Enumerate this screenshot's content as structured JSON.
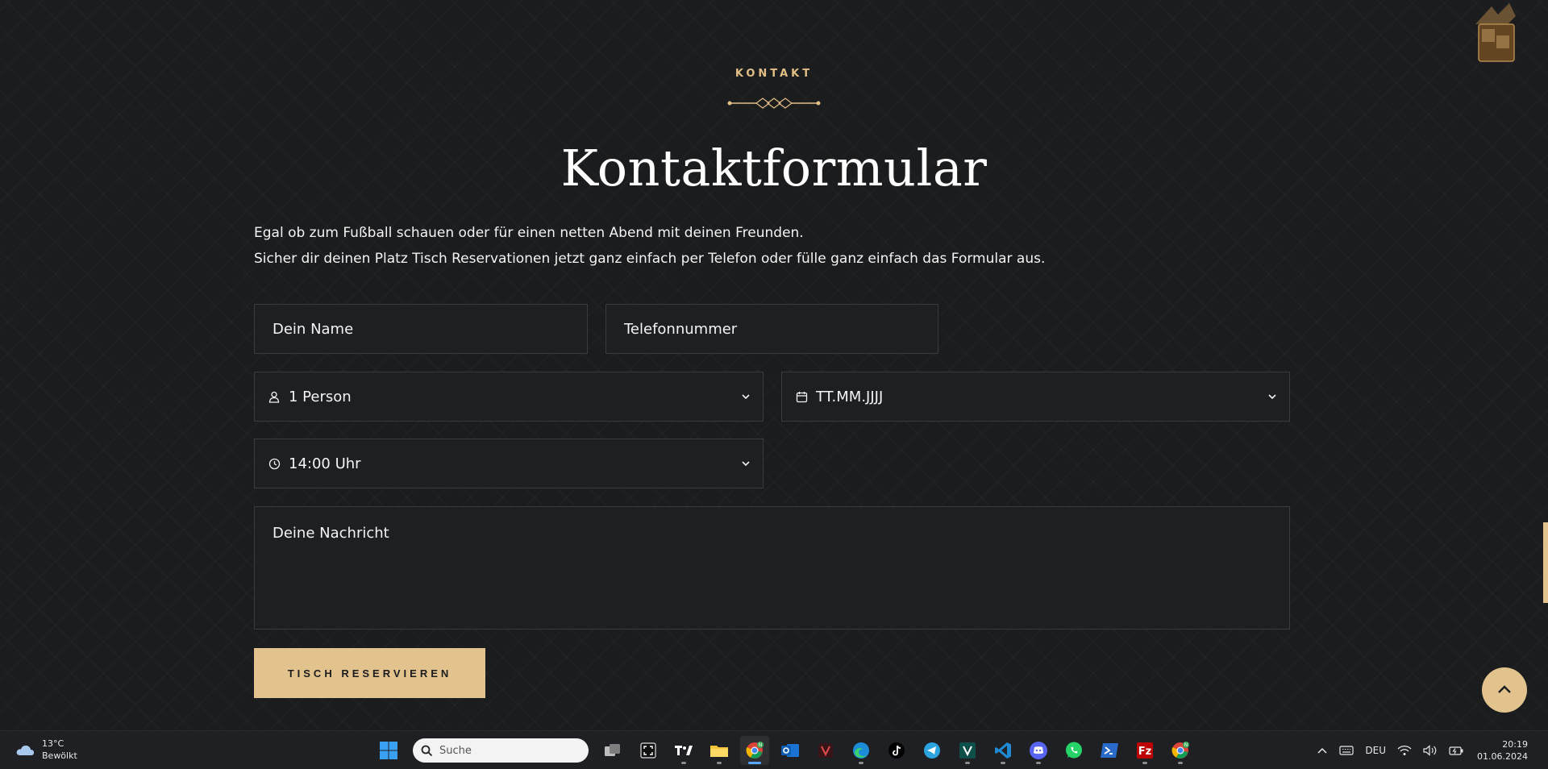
{
  "section": {
    "eyebrow": "KONTAKT",
    "title": "Kontaktformular",
    "intro_line1": "Egal ob zum Fußball schauen oder für einen netten Abend mit deinen Freunden.",
    "intro_line2": "Sicher dir deinen Platz Tisch Reservationen jetzt ganz einfach per Telefon oder fülle ganz einfach das Formular aus."
  },
  "form": {
    "name_placeholder": "Dein Name",
    "phone_placeholder": "Telefonnummer",
    "persons_value": "1 Person",
    "date_value": "TT.MM.JJJJ",
    "time_value": "14:00 Uhr",
    "message_placeholder": "Deine Nachricht",
    "submit_label": "TISCH RESERVIEREN"
  },
  "colors": {
    "accent": "#e2c38d",
    "background": "#1b1c1e",
    "field_background": "#1e1f22",
    "field_border": "#3a3b3e"
  },
  "taskbar": {
    "weather_temp": "13°C",
    "weather_desc": "Bewölkt",
    "search_placeholder": "Suche",
    "apps": [
      "windows-start-icon",
      "task-view-icon",
      "screen-capture-icon",
      "tradingview-icon",
      "file-explorer-icon",
      "chrome-icon",
      "outlook-icon",
      "gaming-app-icon",
      "edge-icon",
      "tiktok-icon",
      "telegram-icon",
      "vectorworks-icon",
      "vscode-icon",
      "discord-icon",
      "whatsapp-icon",
      "powershell-icon",
      "filezilla-icon",
      "chrome-profile-icon"
    ],
    "language": "DEU",
    "time": "20:19",
    "date": "01.06.2024"
  }
}
